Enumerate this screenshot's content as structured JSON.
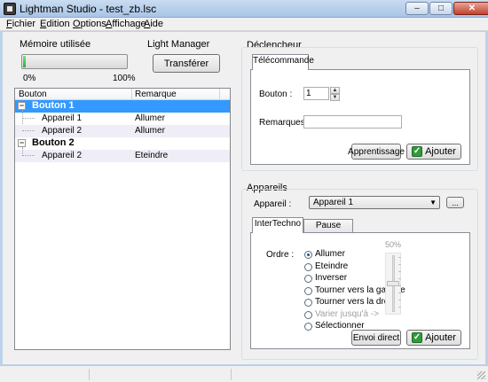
{
  "window": {
    "title": "Lightman Studio - test_zb.lsc",
    "minimize": "–",
    "maximize": "□",
    "close": "✕"
  },
  "menu": [
    {
      "u": "F",
      "rest": "ichier"
    },
    {
      "u": "E",
      "rest": "dition"
    },
    {
      "u": "O",
      "rest": "ptions"
    },
    {
      "u": "A",
      "rest": "ffichage"
    },
    {
      "u": "A",
      "rest": "ide"
    }
  ],
  "memory": {
    "label": "Mémoire utilisée",
    "min": "0%",
    "max": "100%",
    "value": 0.03
  },
  "light_manager": {
    "label": "Light Manager",
    "button": "Transférer"
  },
  "tree": {
    "columns": [
      "Bouton",
      "Remarque"
    ],
    "rows": [
      {
        "name": "Bouton 1",
        "remark": "",
        "level": 0
      },
      {
        "name": "Appareil 1",
        "remark": "Allumer",
        "level": 1
      },
      {
        "name": "Appareil 2",
        "remark": "Allumer",
        "level": 1
      },
      {
        "name": "Bouton 2",
        "remark": "",
        "level": 0
      },
      {
        "name": "Appareil 2",
        "remark": "Eteindre",
        "level": 1
      }
    ]
  },
  "trigger": {
    "label": "Déclencheur",
    "tab": "Télécommande",
    "bouton_label": "Bouton :",
    "bouton_value": "1",
    "remarques_label": "Remarques :",
    "remarques_value": "",
    "learn_button": "Apprentissage",
    "add_button": "Ajouter"
  },
  "devices": {
    "label": "Appareils",
    "device_label": "Appareil :",
    "device_value": "Appareil 1",
    "browse_button": "...",
    "tabs": [
      "InterTechno",
      "Pause"
    ],
    "order_label": "Ordre :",
    "options": [
      "Allumer",
      "Eteindre",
      "Inverser",
      "Tourner vers la gauche",
      "Tourner vers la droite",
      "Varier jusqu'à ->",
      "Sélectionner"
    ],
    "selected": "Allumer",
    "disabled": [
      "Varier jusqu'à ->"
    ],
    "slider_label": "50%",
    "slider_level": 0.5,
    "send_button": "Envoi direct",
    "add_button": "Ajouter"
  }
}
